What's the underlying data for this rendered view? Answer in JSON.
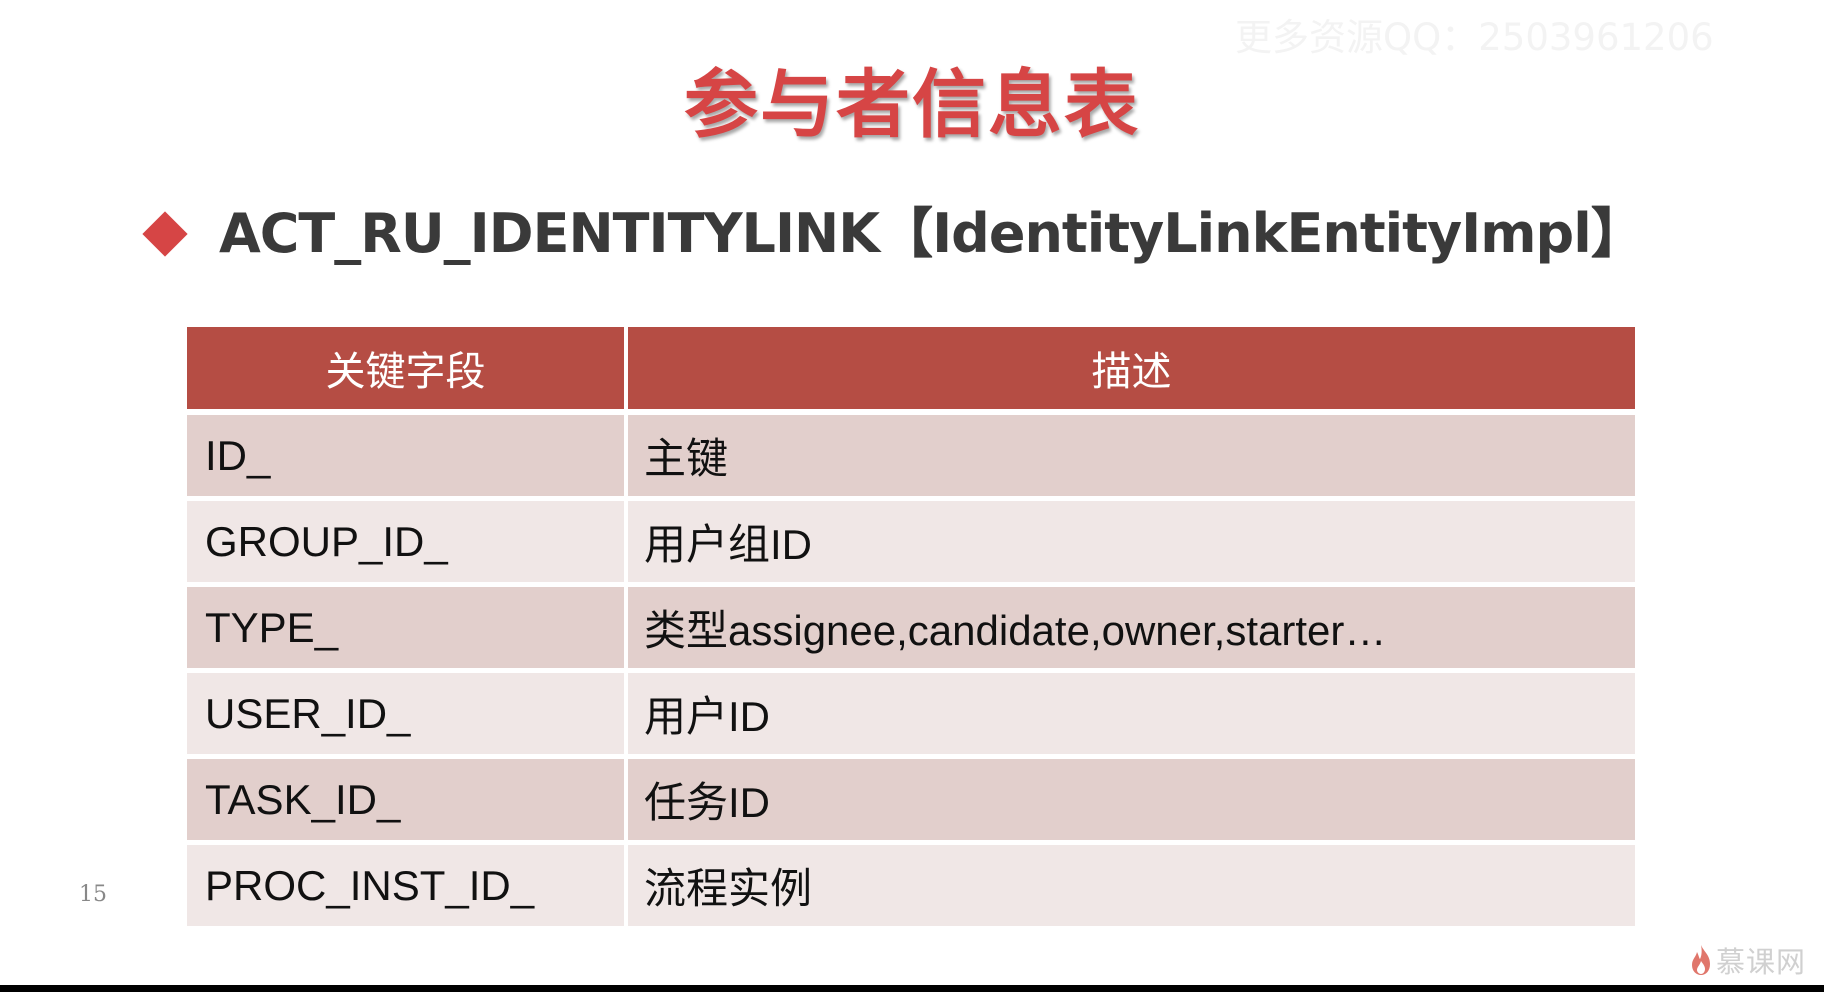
{
  "watermark": "更多资源QQ：2503961206",
  "slide": {
    "title": "参与者信息表",
    "bullet": "ACT_RU_IDENTITYLINK【IdentityLinkEntityImpl】",
    "page_number": "15",
    "brand": "慕课网"
  },
  "table": {
    "headers": [
      "关键字段",
      "描述"
    ],
    "rows": [
      {
        "field": "ID_",
        "description": "主键"
      },
      {
        "field": "GROUP_ID_",
        "description": "用户组ID"
      },
      {
        "field": "TYPE_",
        "description": "类型assignee,candidate,owner,starter…"
      },
      {
        "field": "USER_ID_",
        "description": "用户ID"
      },
      {
        "field": "TASK_ID_",
        "description": "任务ID"
      },
      {
        "field": "PROC_INST_ID_",
        "description": "流程实例"
      }
    ]
  },
  "colors": {
    "title": "#d64545",
    "header_bg": "#b54d44",
    "row_odd": "#e2cfcc",
    "row_even": "#f0e7e6"
  }
}
